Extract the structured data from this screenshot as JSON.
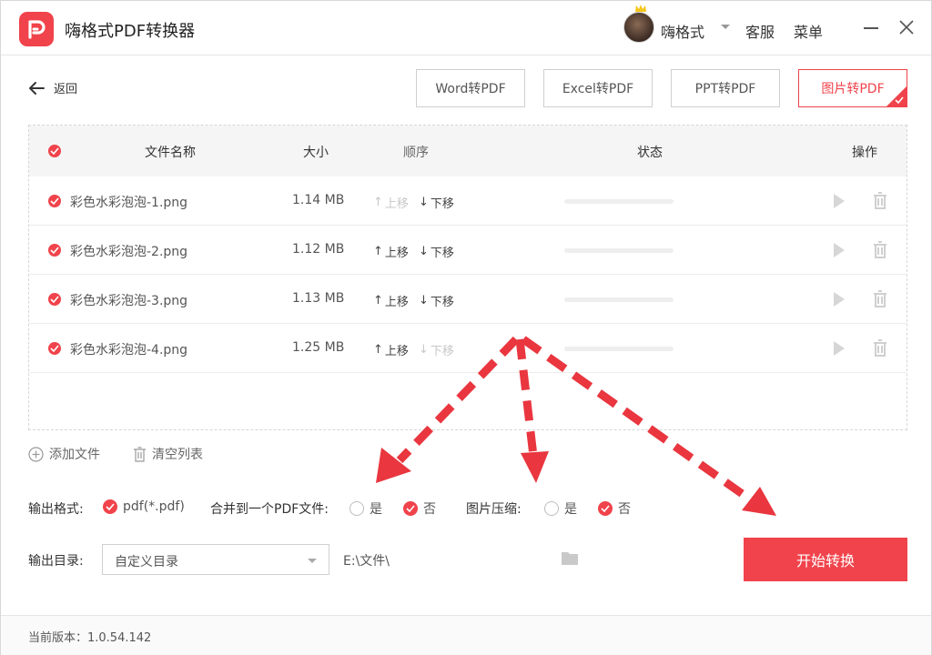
{
  "app": {
    "title": "嗨格式PDF转换器"
  },
  "header": {
    "username": "嗨格式",
    "service": "客服",
    "menu": "菜单"
  },
  "toolbar": {
    "back_label": "返回",
    "tabs": [
      {
        "label": "Word转PDF",
        "active": false
      },
      {
        "label": "Excel转PDF",
        "active": false
      },
      {
        "label": "PPT转PDF",
        "active": false
      },
      {
        "label": "图片转PDF",
        "active": true
      }
    ]
  },
  "table": {
    "columns": {
      "name": "文件名称",
      "size": "大小",
      "order": "顺序",
      "status": "状态",
      "actions": "操作"
    },
    "move_up": "上移",
    "move_down": "下移",
    "rows": [
      {
        "name": "彩色水彩泡泡-1.png",
        "size": "1.14 MB",
        "up_enabled": false,
        "down_enabled": true
      },
      {
        "name": "彩色水彩泡泡-2.png",
        "size": "1.12 MB",
        "up_enabled": true,
        "down_enabled": true
      },
      {
        "name": "彩色水彩泡泡-3.png",
        "size": "1.13 MB",
        "up_enabled": true,
        "down_enabled": true
      },
      {
        "name": "彩色水彩泡泡-4.png",
        "size": "1.25 MB",
        "up_enabled": true,
        "down_enabled": false
      }
    ]
  },
  "actions": {
    "add_file": "添加文件",
    "clear_list": "清空列表"
  },
  "options": {
    "output_format_label": "输出格式:",
    "output_format_value": "pdf(*.pdf)",
    "merge_label": "合并到一个PDF文件:",
    "merge_yes": "是",
    "merge_no": "否",
    "merge_selected": "否",
    "compress_label": "图片压缩:",
    "compress_yes": "是",
    "compress_no": "否",
    "compress_selected": "否"
  },
  "output_dir": {
    "label": "输出目录:",
    "selected": "自定义目录",
    "path": "E:\\文件\\"
  },
  "start_button": "开始转换",
  "footer": {
    "version": "当前版本：1.0.54.142"
  },
  "colors": {
    "accent": "#f0434b"
  }
}
